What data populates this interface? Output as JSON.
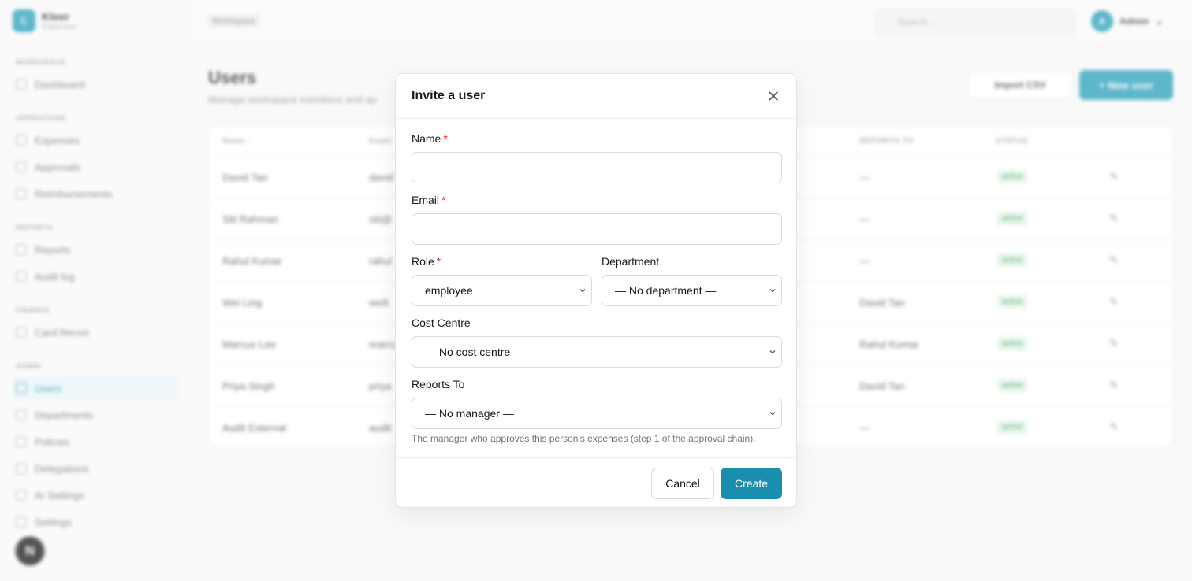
{
  "brand": {
    "logo_letter": "E",
    "name": "Kleer",
    "subtitle": "Expenses"
  },
  "sidebar": {
    "sections": [
      {
        "label": "WORKSPACE",
        "items": [
          {
            "label": "Dashboard",
            "icon": "grid-icon"
          }
        ]
      },
      {
        "label": "OPERATIONS",
        "items": [
          {
            "label": "Expenses",
            "icon": "receipt-icon"
          },
          {
            "label": "Approvals",
            "icon": "check-icon"
          },
          {
            "label": "Reimbursements",
            "icon": "wallet-icon"
          }
        ]
      },
      {
        "label": "REPORTS",
        "items": [
          {
            "label": "Reports",
            "icon": "chart-icon"
          },
          {
            "label": "Audit log",
            "icon": "log-icon"
          }
        ]
      },
      {
        "label": "FINANCE",
        "items": [
          {
            "label": "Card Recon",
            "icon": "card-icon"
          }
        ]
      },
      {
        "label": "ADMIN",
        "items": [
          {
            "label": "Users",
            "icon": "users-icon",
            "active": true
          },
          {
            "label": "Departments",
            "icon": "building-icon"
          },
          {
            "label": "Policies",
            "icon": "policy-icon"
          },
          {
            "label": "Delegations",
            "icon": "delegate-icon"
          },
          {
            "label": "AI Settings",
            "icon": "sparkle-icon"
          },
          {
            "label": "Settings",
            "icon": "gear-icon"
          }
        ]
      }
    ]
  },
  "dev_badge": "N",
  "topbar": {
    "breadcrumb": "Workspace",
    "search_placeholder": "Search...",
    "user_initial": "A",
    "user_name": "Admin"
  },
  "page": {
    "title": "Users",
    "subtitle": "Manage workspace members and ap",
    "import_label": "Import CSV",
    "new_label": "+ New user"
  },
  "table": {
    "headers": {
      "name": "Name ↑",
      "email": "Email",
      "reports_to": "REPORTS TO",
      "status": "STATUS"
    },
    "rows": [
      {
        "name": "David Tan",
        "email": "david",
        "reports_to": "—",
        "status": "active"
      },
      {
        "name": "Siti Rahman",
        "email": "siti@",
        "reports_to": "—",
        "status": "active"
      },
      {
        "name": "Rahul Kumar",
        "email": "rahul",
        "reports_to": "—",
        "status": "active"
      },
      {
        "name": "Wei Ling",
        "email": "weili",
        "reports_to": "David Tan",
        "status": "active"
      },
      {
        "name": "Marcus Lee",
        "email": "marcu",
        "reports_to": "Rahul Kumar",
        "status": "active"
      },
      {
        "name": "Priya Singh",
        "email": "priya",
        "reports_to": "David Tan",
        "status": "active"
      },
      {
        "name": "Audit External",
        "email": "audit",
        "reports_to": "—",
        "status": "active"
      }
    ]
  },
  "modal": {
    "title": "Invite a user",
    "name_label": "Name",
    "name_value": "",
    "email_label": "Email",
    "email_value": "",
    "role_label": "Role",
    "role_value": "employee",
    "department_label": "Department",
    "department_value": "— No department —",
    "cost_centre_label": "Cost Centre",
    "cost_centre_value": "— No cost centre —",
    "reports_to_label": "Reports To",
    "reports_to_value": "— No manager —",
    "reports_to_hint": "The manager who approves this person's expenses (step 1 of the approval chain).",
    "required_mark": "*",
    "cancel_label": "Cancel",
    "create_label": "Create"
  },
  "colors": {
    "accent": "#1a8fad",
    "required": "#dc2626"
  }
}
